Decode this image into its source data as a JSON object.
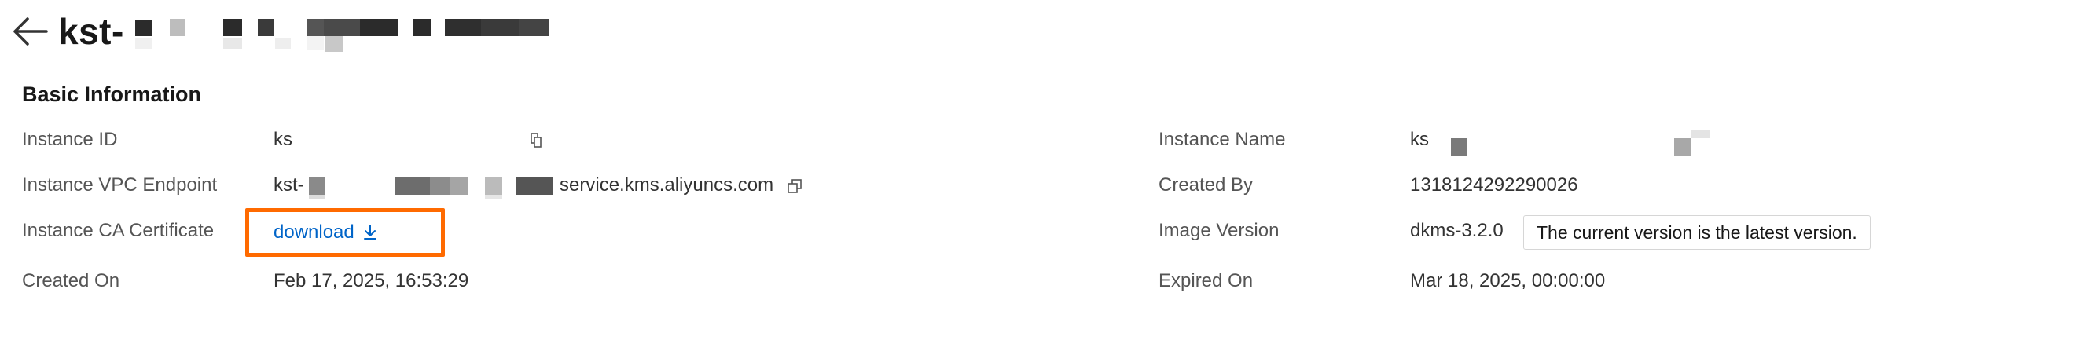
{
  "header": {
    "title": "kst-"
  },
  "section": {
    "title": "Basic Information"
  },
  "fields": {
    "instance_id": {
      "label": "Instance ID",
      "value": "ks"
    },
    "vpc_endpoint": {
      "label": "Instance VPC Endpoint",
      "prefix": "kst-",
      "suffix": "service.kms.aliyuncs.com"
    },
    "ca_certificate": {
      "label": "Instance CA Certificate",
      "link": "download"
    },
    "created_on": {
      "label": "Created On",
      "value": "Feb 17, 2025, 16:53:29"
    },
    "instance_name": {
      "label": "Instance Name",
      "value": "ks"
    },
    "created_by": {
      "label": "Created By",
      "value": "1318124292290026"
    },
    "image_version": {
      "label": "Image Version",
      "value": "dkms-3.2.0",
      "tag": "The current version is the latest version."
    },
    "expired_on": {
      "label": "Expired On",
      "value": "Mar 18, 2025, 00:00:00"
    }
  },
  "colors": {
    "link": "#0064c8",
    "highlight_border": "#ff6a00"
  }
}
